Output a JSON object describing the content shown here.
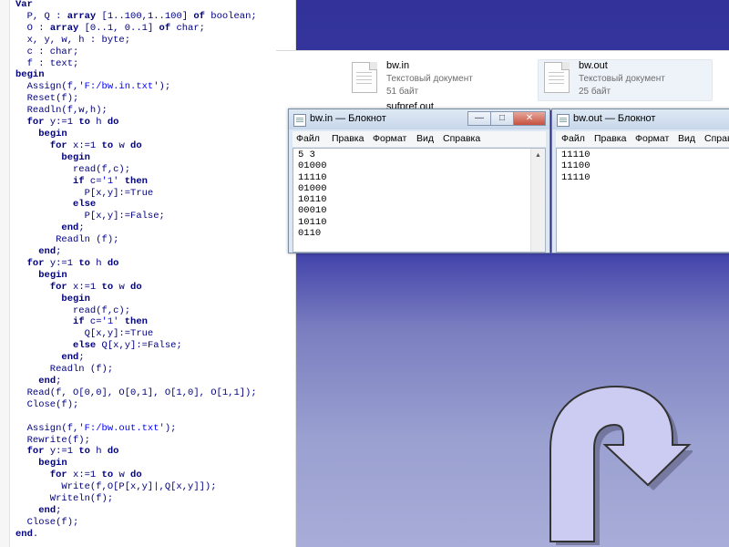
{
  "code": {
    "lines": [
      "Var",
      "  P, Q : array [1..100,1..100] of boolean;",
      "  O : array [0..1, 0..1] of char;",
      "  x, y, w, h : byte;",
      "  c : char;",
      "  f : text;",
      "begin",
      "  Assign(f,'F:/bw.in.txt');",
      "  Reset(f);",
      "  Readln(f,w,h);",
      "  for y:=1 to h do",
      "    begin",
      "      for x:=1 to w do",
      "        begin",
      "          read(f,c);",
      "          if c='1' then",
      "            P[x,y]:=True",
      "          else",
      "            P[x,y]:=False;",
      "        end;",
      "       Readln (f);",
      "    end;",
      "  for y:=1 to h do",
      "    begin",
      "      for x:=1 to w do",
      "        begin",
      "          read(f,c);",
      "          if c='1' then",
      "            Q[x,y]:=True",
      "          else Q[x,y]:=False;",
      "        end;",
      "      Readln (f);",
      "    end;",
      "  Read(f, O[0,0], O[0,1], O[1,0], O[1,1]);",
      "  Close(f);",
      "",
      "  Assign(f,'F:/bw.out.txt');",
      "  Rewrite(f);",
      "  for y:=1 to h do",
      "    begin",
      "      for x:=1 to w do",
      "        Write(f,O[P[x,y]|,Q[x,y]]);",
      "      Writeln(f);",
      "    end;",
      "  Close(f);",
      "end."
    ]
  },
  "explorer": {
    "files": [
      {
        "name": "bw.in",
        "type": "Текстовый документ",
        "size": "51 байт"
      },
      {
        "name": "bw.out",
        "type": "Текстовый документ",
        "size": "25 байт"
      },
      {
        "name": "sufpref.out",
        "type": "",
        "size": ""
      }
    ]
  },
  "notepad_in": {
    "title": "bw.in — Блокнот",
    "menu": [
      "Файл",
      "Правка",
      "Формат",
      "Вид",
      "Справка"
    ],
    "content": "5 3\n01000\n11110\n01000\n10110\n00010\n10110\n0110",
    "buttons": {
      "minimize": "—",
      "maximize": "□",
      "close": "✕"
    }
  },
  "notepad_out": {
    "title": "bw.out — Блокнот",
    "menu": [
      "Файл",
      "Правка",
      "Формат",
      "Вид",
      "Справ"
    ],
    "content": "11110\n11100\n11110"
  },
  "colors": {
    "slide_blue_top": "#32329a",
    "slide_blue_bottom": "#a8acd8",
    "arrow_fill": "#ccccf2",
    "arrow_stroke": "#333333",
    "code_text": "#000080",
    "code_string": "#0000ff"
  },
  "icons": {
    "u_turn_arrow": "curved-return-arrow-icon",
    "text_file": "text-document-icon",
    "notepad": "notepad-icon"
  }
}
